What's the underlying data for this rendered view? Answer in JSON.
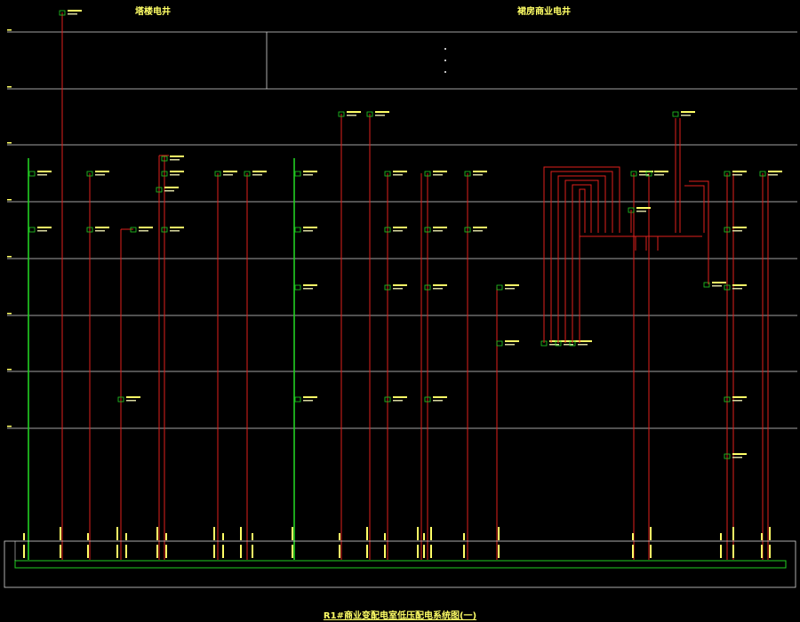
{
  "headings": {
    "left_shaft": "塔楼电井",
    "right_shaft": "裙房商业电井"
  },
  "drawing_title": "R1#商业变配电室低压配电系统图(一)",
  "colors": {
    "background": "#000000",
    "floor_line": "#d8d8d8",
    "feeder": "#e0201c",
    "bus": "#22d022",
    "label": "#ffff66",
    "box": "#22d022"
  }
}
